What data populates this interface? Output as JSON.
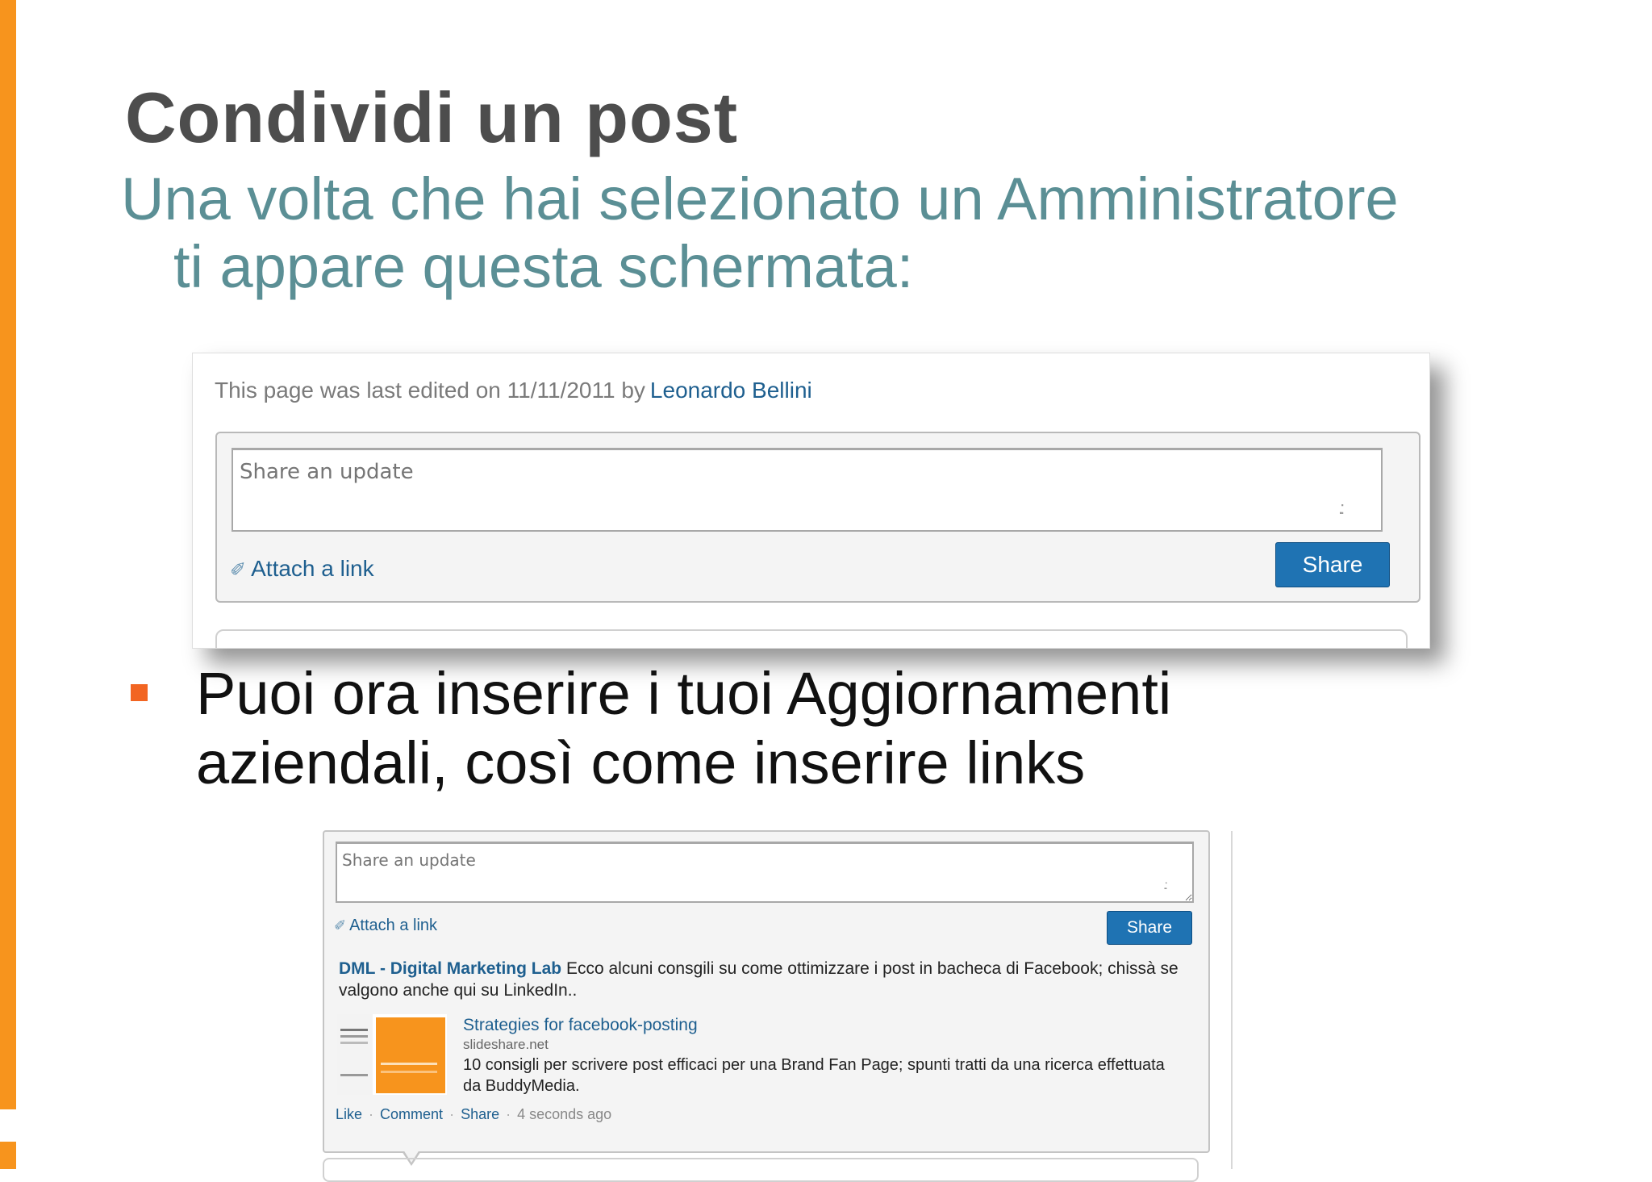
{
  "slide": {
    "title": "Condividi un post",
    "subtitle_line1": "Una volta che hai selezionato un Amministratore",
    "subtitle_line2": "ti appare questa schermata:",
    "bullet_line1": "Puoi ora inserire i tuoi Aggiornamenti",
    "bullet_line2": "aziendali, così come inserire links",
    "colors": {
      "accent": "#f7941d",
      "bullet": "#f26522",
      "subtitle": "#5b8f95",
      "link": "#1e5f8f",
      "button": "#1f73b3"
    }
  },
  "screenshot1": {
    "edit_note": "This page was last edited on 11/11/2011 by",
    "edit_author": "Leonardo Bellini",
    "placeholder": "Share an update",
    "attach_label": "Attach a link",
    "share_label": "Share",
    "icons": {
      "attach": "paperclip-icon",
      "resize": "resize-grip-icon"
    }
  },
  "screenshot2": {
    "placeholder": "Share an update",
    "attach_label": "Attach a link",
    "share_label": "Share",
    "post": {
      "author": "DML - Digital Marketing Lab",
      "text": "Ecco alcuni consgili su come ottimizzare i post in bacheca di Facebook; chissà se valgono anche qui su LinkedIn..",
      "link_title": "Strategies for facebook-posting",
      "link_domain": "slideshare.net",
      "link_description": "10 consigli per scrivere post efficaci per una Brand Fan Page; spunti tratti da una ricerca effettuata da BuddyMedia.",
      "actions": {
        "like": "Like",
        "comment": "Comment",
        "share": "Share",
        "time": "4 seconds ago"
      }
    }
  }
}
